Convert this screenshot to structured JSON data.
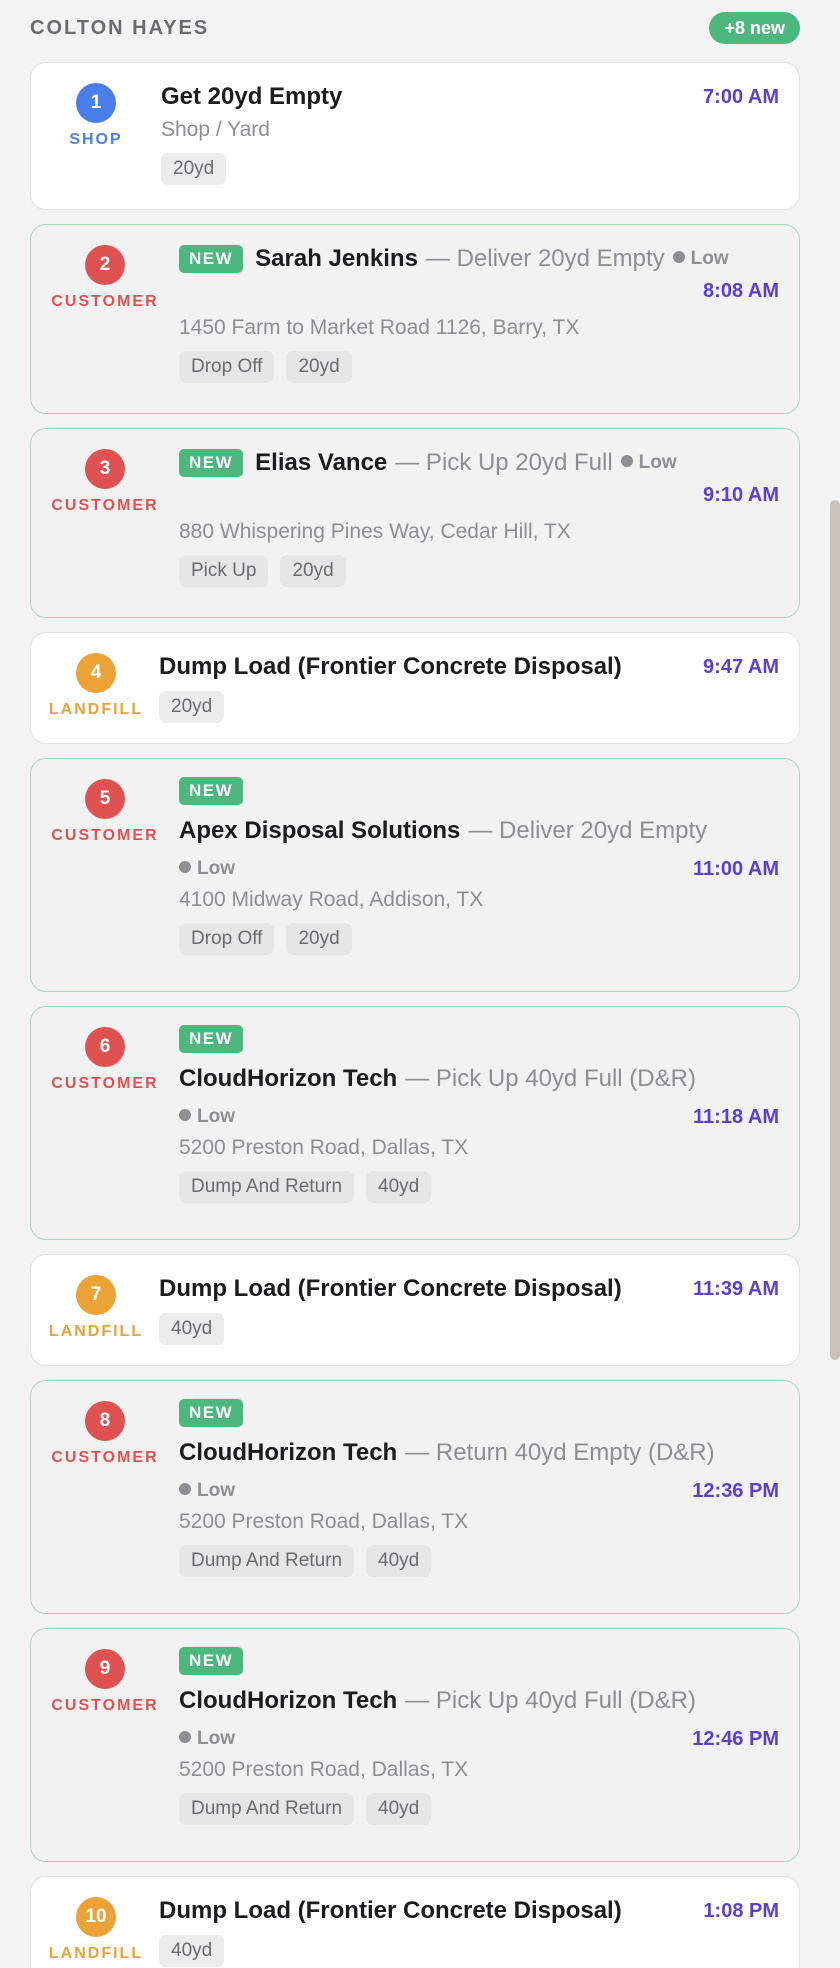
{
  "header": {
    "driver": "COLTON HAYES",
    "new_badge": "+8 new"
  },
  "colors": {
    "shop": "#4a7fea",
    "customer": "#e05252",
    "landfill": "#eba338",
    "new_green": "#4cb87e",
    "time": "#5b3fd3"
  },
  "stops": [
    {
      "num": "1",
      "type": "SHOP",
      "title": "Get 20yd Empty",
      "time": "7:00 AM",
      "address": "Shop / Yard",
      "tags": [
        "20yd"
      ]
    },
    {
      "num": "2",
      "type": "CUSTOMER",
      "new_label": "NEW",
      "title": "Sarah Jenkins",
      "sub": "— Deliver 20yd Empty",
      "priority": "Low",
      "time": "8:08 AM",
      "address": "1450 Farm to Market Road 1126, Barry, TX",
      "tags": [
        "Drop Off",
        "20yd"
      ]
    },
    {
      "num": "3",
      "type": "CUSTOMER",
      "new_label": "NEW",
      "title": "Elias Vance",
      "sub": "— Pick Up 20yd Full",
      "priority": "Low",
      "time": "9:10 AM",
      "address": "880 Whispering Pines Way, Cedar Hill, TX",
      "tags": [
        "Pick Up",
        "20yd"
      ]
    },
    {
      "num": "4",
      "type": "LANDFILL",
      "title": "Dump Load (Frontier Concrete Disposal)",
      "time": "9:47 AM",
      "tags": [
        "20yd"
      ]
    },
    {
      "num": "5",
      "type": "CUSTOMER",
      "new_label": "NEW",
      "title": "Apex Disposal Solutions",
      "sub": "— Deliver 20yd Empty",
      "priority": "Low",
      "time": "11:00 AM",
      "address": "4100 Midway Road, Addison, TX",
      "tags": [
        "Drop Off",
        "20yd"
      ]
    },
    {
      "num": "6",
      "type": "CUSTOMER",
      "new_label": "NEW",
      "title": "CloudHorizon Tech",
      "sub": "— Pick Up 40yd Full (D&R)",
      "priority": "Low",
      "time": "11:18 AM",
      "address": "5200 Preston Road, Dallas, TX",
      "tags": [
        "Dump And Return",
        "40yd"
      ]
    },
    {
      "num": "7",
      "type": "LANDFILL",
      "title": "Dump Load (Frontier Concrete Disposal)",
      "time": "11:39 AM",
      "tags": [
        "40yd"
      ]
    },
    {
      "num": "8",
      "type": "CUSTOMER",
      "new_label": "NEW",
      "title": "CloudHorizon Tech",
      "sub": "— Return 40yd Empty (D&R)",
      "priority": "Low",
      "time": "12:36 PM",
      "address": "5200 Preston Road, Dallas, TX",
      "tags": [
        "Dump And Return",
        "40yd"
      ]
    },
    {
      "num": "9",
      "type": "CUSTOMER",
      "new_label": "NEW",
      "title": "CloudHorizon Tech",
      "sub": "— Pick Up 40yd Full (D&R)",
      "priority": "Low",
      "time": "12:46 PM",
      "address": "5200 Preston Road, Dallas, TX",
      "tags": [
        "Dump And Return",
        "40yd"
      ]
    },
    {
      "num": "10",
      "type": "LANDFILL",
      "title": "Dump Load (Frontier Concrete Disposal)",
      "time": "1:08 PM",
      "tags": [
        "40yd"
      ]
    }
  ]
}
